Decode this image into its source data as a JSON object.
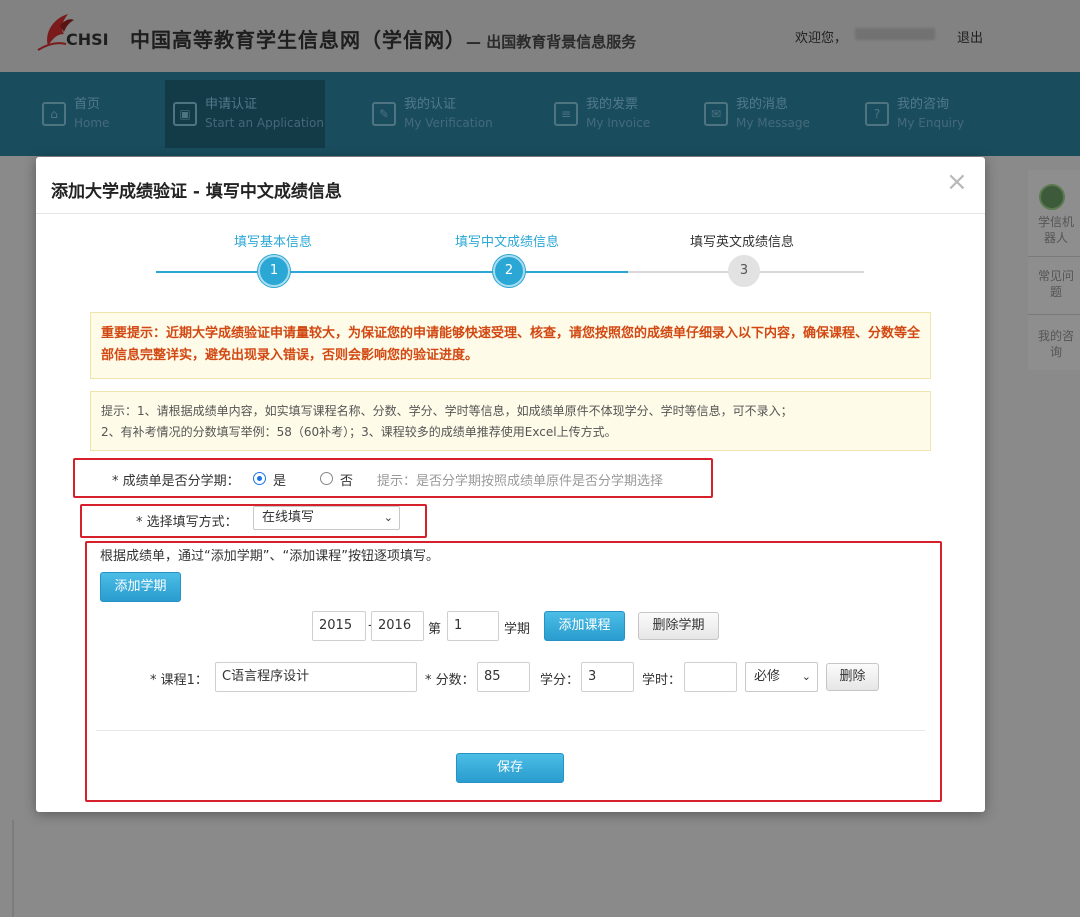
{
  "header": {
    "logo_text": "CHSI",
    "site_title": "中国高等教育学生信息网（学信网）",
    "site_subtitle": "— 出国教育背景信息服务",
    "welcome": "欢迎您，",
    "logout": "退出"
  },
  "nav": {
    "items": [
      {
        "zh": "首页",
        "en": "Home"
      },
      {
        "zh": "申请认证",
        "en": "Start an Application"
      },
      {
        "zh": "我的认证",
        "en": "My Verification"
      },
      {
        "zh": "我的发票",
        "en": "My Invoice"
      },
      {
        "zh": "我的消息",
        "en": "My Message"
      },
      {
        "zh": "我的咨询",
        "en": "My Enquiry"
      }
    ]
  },
  "right_panel": {
    "items": [
      "学信机器人",
      "常见问题",
      "我的咨询"
    ]
  },
  "modal": {
    "title": "添加大学成绩验证 - 填写中文成绩信息",
    "close": "×",
    "steps": [
      {
        "label": "填写基本信息",
        "number": "1",
        "status": "done"
      },
      {
        "label": "填写中文成绩信息",
        "number": "2",
        "status": "done"
      },
      {
        "label": "填写英文成绩信息",
        "number": "3",
        "status": "todo"
      }
    ],
    "notice": "重要提示：近期大学成绩验证申请量较大，为保证您的申请能够快速受理、核查，请您按照您的成绩单仔细录入以下内容，确保课程、分数等全部信息完整详实，避免出现录入错误，否则会影响您的验证进度。",
    "tips_line1": "提示：1、请根据成绩单内容，如实填写课程名称、分数、学分、学时等信息，如成绩单原件不体现学分、学时等信息，可不录入；",
    "tips_line2": "2、有补考情况的分数填写举例：58（60补考）；3、课程较多的成绩单推荐使用Excel上传方式。",
    "semester_question": "* 成绩单是否分学期：",
    "yes_label": "是",
    "no_label": "否",
    "semester_hint": "提示：是否分学期按照成绩单原件是否分学期选择",
    "method_label": "* 选择填写方式：",
    "method_value": "在线填写",
    "instruction": "根据成绩单，通过“添加学期”、“添加课程”按钮逐项填写。",
    "add_semester": "添加学期",
    "year_start": "2015",
    "dash": "-",
    "year_end": "2016",
    "di": "第",
    "term_no": "1",
    "xueqi": "学期",
    "add_course": "添加课程",
    "delete_semester": "删除学期",
    "course_label": "* 课程1：",
    "course_name": "C语言程序设计",
    "score_label": "* 分数：",
    "score": "85",
    "credit_label": "学分：",
    "credit": "3",
    "hours_label": "学时：",
    "hours": "",
    "course_type": "必修",
    "delete": "删除",
    "save": "保存"
  },
  "colors": {
    "accent": "#2aa7d5",
    "notice_text": "#d24812",
    "highlight_box": "#d6202c",
    "nav_bg": "#194d5e"
  }
}
